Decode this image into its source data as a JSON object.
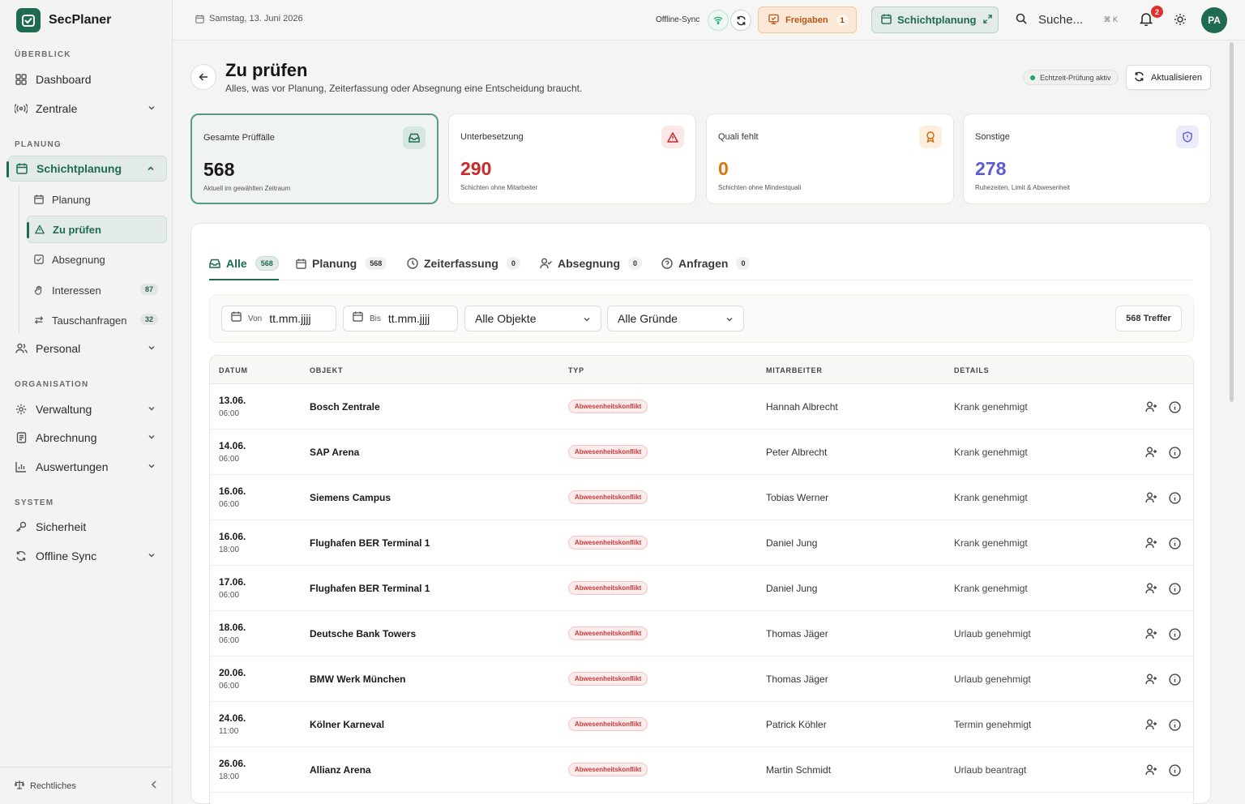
{
  "app": {
    "name": "SecPlaner"
  },
  "sidebar": {
    "sections": {
      "overview": "ÜBERBLICK",
      "planning": "PLANUNG",
      "organisation": "ORGANISATION",
      "system": "SYSTEM"
    },
    "items": {
      "dashboard": "Dashboard",
      "zentrale": "Zentrale",
      "schichtplanung": "Schichtplanung",
      "personal": "Personal",
      "verwaltung": "Verwaltung",
      "abrechnung": "Abrechnung",
      "auswertungen": "Auswertungen",
      "sicherheit": "Sicherheit",
      "offline_sync": "Offline Sync"
    },
    "subitems": {
      "planung": "Planung",
      "zu_pruefen": "Zu prüfen",
      "absegnung": "Absegnung",
      "interessen": "Interessen",
      "interessen_count": "87",
      "tauschanfragen": "Tauschanfragen",
      "tauschanfragen_count": "32"
    },
    "footer": "Rechtliches"
  },
  "topbar": {
    "date": "Samstag, 13. Juni 2026",
    "sync_label": "Offline-Sync",
    "freigaben_label": "Freigaben",
    "freigaben_count": "1",
    "schichtplanung_label": "Schichtplanung",
    "search_placeholder": "Suche...",
    "search_shortcut": "⌘ K",
    "notification_count": "2",
    "avatar_initials": "PA"
  },
  "page": {
    "title": "Zu prüfen",
    "subtitle": "Alles, was vor Planung, Zeiterfassung oder Absegnung eine Entscheidung braucht.",
    "live_status": "Echtzeit-Prüfung aktiv",
    "refresh_label": "Aktualisieren"
  },
  "stats": [
    {
      "label": "Gesamte Prüffälle",
      "value": "568",
      "note": "Aktuell im gewählten Zeitraum",
      "color": "#1a1a1a"
    },
    {
      "label": "Unterbesetzung",
      "value": "290",
      "note": "Schichten ohne Mitarbeiter",
      "color": "#c92a2a"
    },
    {
      "label": "Quali fehlt",
      "value": "0",
      "note": "Schichten ohne Mindestquali",
      "color": "#d9770b"
    },
    {
      "label": "Sonstige",
      "value": "278",
      "note": "Ruhezeiten, Limit & Abwesenheit",
      "color": "#5b5bd6"
    }
  ],
  "tabs": [
    {
      "label": "Alle",
      "count": "568"
    },
    {
      "label": "Planung",
      "count": "568"
    },
    {
      "label": "Zeiterfassung",
      "count": "0"
    },
    {
      "label": "Absegnung",
      "count": "0"
    },
    {
      "label": "Anfragen",
      "count": "0"
    }
  ],
  "filters": {
    "from_label": "Von",
    "from_value": "tt.mm.jjjj",
    "to_label": "Bis",
    "to_value": "tt.mm.jjjj",
    "objects": "Alle Objekte",
    "reasons": "Alle Gründe",
    "hits": "568 Treffer"
  },
  "table": {
    "headers": [
      "DATUM",
      "OBJEKT",
      "TYP",
      "MITARBEITER",
      "DETAILS"
    ],
    "rows": [
      {
        "date": "13.06.",
        "time": "06:00",
        "object": "Bosch Zentrale",
        "type": "Abwesenheitskonflikt",
        "employee": "Hannah Albrecht",
        "details": "Krank genehmigt"
      },
      {
        "date": "14.06.",
        "time": "06:00",
        "object": "SAP Arena",
        "type": "Abwesenheitskonflikt",
        "employee": "Peter Albrecht",
        "details": "Krank genehmigt"
      },
      {
        "date": "16.06.",
        "time": "06:00",
        "object": "Siemens Campus",
        "type": "Abwesenheitskonflikt",
        "employee": "Tobias Werner",
        "details": "Krank genehmigt"
      },
      {
        "date": "16.06.",
        "time": "18:00",
        "object": "Flughafen BER Terminal 1",
        "type": "Abwesenheitskonflikt",
        "employee": "Daniel Jung",
        "details": "Krank genehmigt"
      },
      {
        "date": "17.06.",
        "time": "06:00",
        "object": "Flughafen BER Terminal 1",
        "type": "Abwesenheitskonflikt",
        "employee": "Daniel Jung",
        "details": "Krank genehmigt"
      },
      {
        "date": "18.06.",
        "time": "06:00",
        "object": "Deutsche Bank Towers",
        "type": "Abwesenheitskonflikt",
        "employee": "Thomas Jäger",
        "details": "Urlaub genehmigt"
      },
      {
        "date": "20.06.",
        "time": "06:00",
        "object": "BMW Werk München",
        "type": "Abwesenheitskonflikt",
        "employee": "Thomas Jäger",
        "details": "Urlaub genehmigt"
      },
      {
        "date": "24.06.",
        "time": "11:00",
        "object": "Kölner Karneval",
        "type": "Abwesenheitskonflikt",
        "employee": "Patrick Köhler",
        "details": "Termin genehmigt"
      },
      {
        "date": "26.06.",
        "time": "18:00",
        "object": "Allianz Arena",
        "type": "Abwesenheitskonflikt",
        "employee": "Martin Schmidt",
        "details": "Urlaub beantragt"
      }
    ]
  },
  "colors": {
    "brand": "#1e6b52",
    "danger": "#c92a2a",
    "warning": "#d9770b",
    "info": "#5b5bd6"
  }
}
